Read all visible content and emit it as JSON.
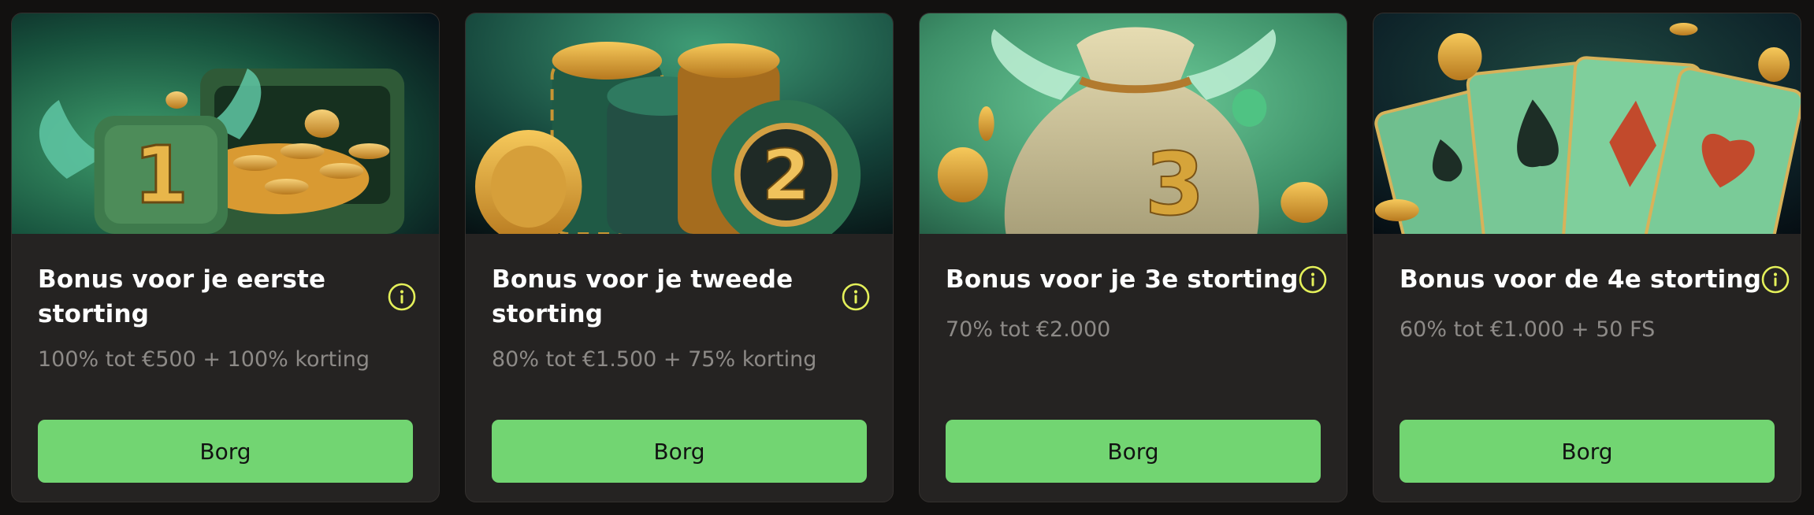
{
  "cards": [
    {
      "title": "Bonus voor je eerste storting",
      "subtitle": "100% tot €500 + 100% korting",
      "button_label": "Borg",
      "image_label": "1"
    },
    {
      "title": "Bonus voor je tweede storting",
      "subtitle": "80% tot €1.500 + 75% korting",
      "button_label": "Borg",
      "image_label": "2"
    },
    {
      "title": "Bonus voor je 3e storting",
      "subtitle": "70% tot €2.000",
      "button_label": "Borg",
      "image_label": "3"
    },
    {
      "title": "Bonus voor de 4e storting",
      "subtitle": "60% tot €1.000 + 50 FS",
      "button_label": "Borg",
      "image_label": ""
    }
  ],
  "icons": {
    "info": "info-icon"
  },
  "colors": {
    "page_background": "#121110",
    "card_background": "#252322",
    "button_green": "#72d572",
    "info_icon_yellow": "#e4f05a",
    "title_white": "#ffffff",
    "subtitle_gray": "#8d8a87"
  }
}
